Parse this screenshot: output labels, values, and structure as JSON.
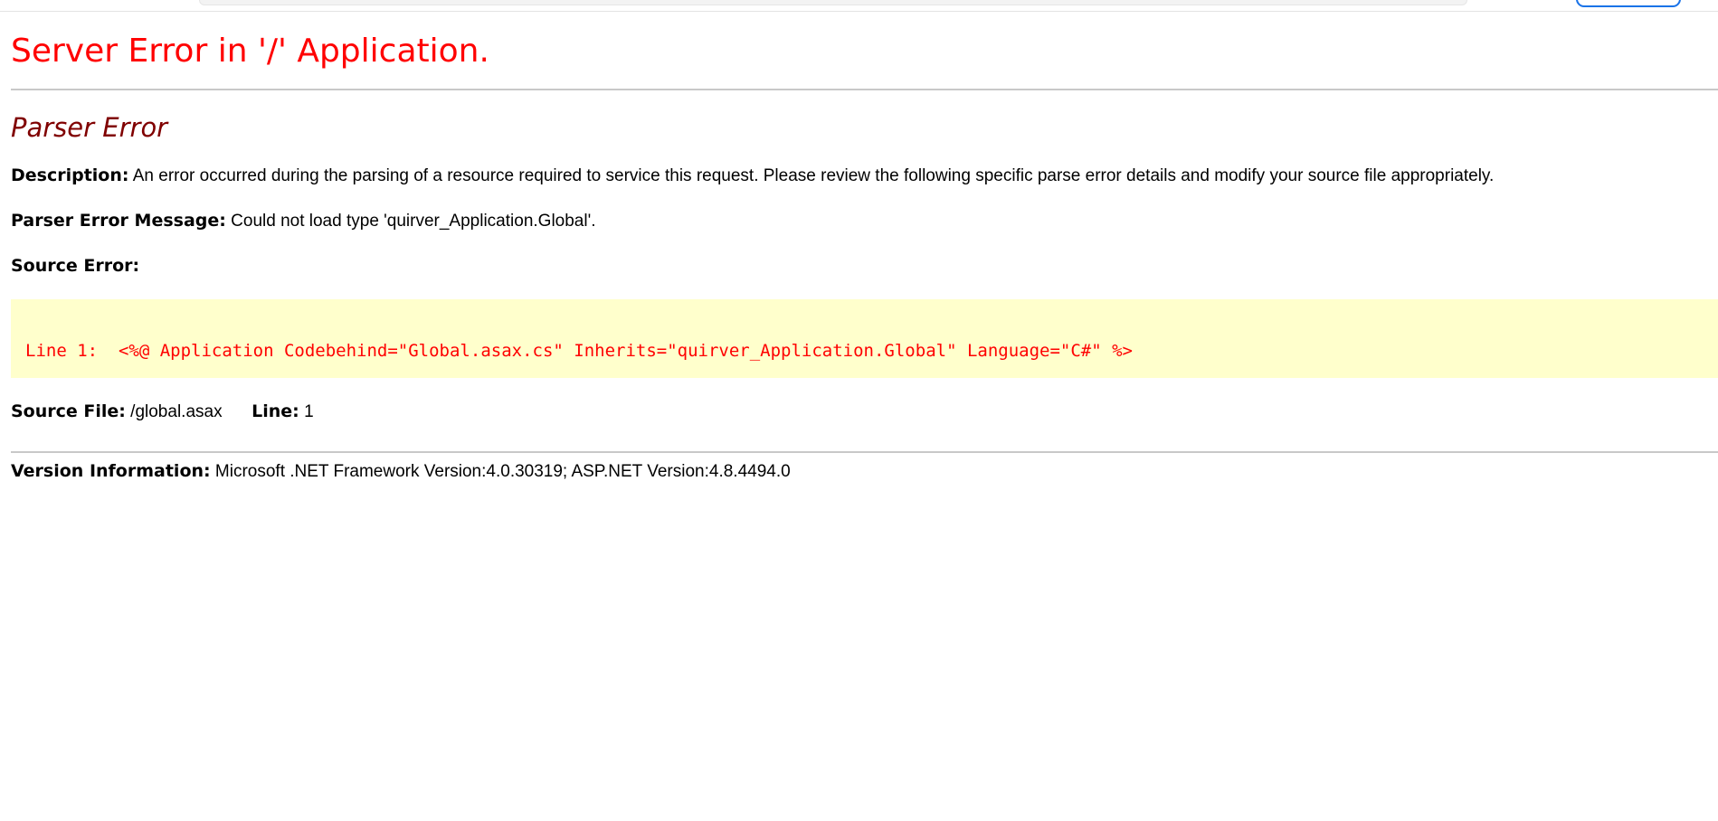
{
  "page": {
    "title": "Server Error in '/' Application.",
    "error_type": "Parser Error"
  },
  "description": {
    "label": "Description:",
    "text": "An error occurred during the parsing of a resource required to service this request. Please review the following specific parse error details and modify your source file appropriately."
  },
  "parser_error_message": {
    "label": "Parser Error Message:",
    "text": "Could not load type 'quirver_Application.Global'."
  },
  "source_error": {
    "label": "Source Error:",
    "code_line": "Line 1:  <%@ Application Codebehind=\"Global.asax.cs\" Inherits=\"quirver_Application.Global\" Language=\"C#\" %>"
  },
  "source_file": {
    "label": "Source File:",
    "value": "/global.asax",
    "line_label": "Line:",
    "line_value": "1"
  },
  "version": {
    "label": "Version Information:",
    "text": "Microsoft .NET Framework Version:4.0.30319; ASP.NET Version:4.8.4494.0"
  },
  "colors": {
    "title": "#ff0000",
    "error_type": "#800000",
    "code_background": "#ffffcc",
    "code_text": "#ff0000",
    "rule": "#c8c8c8"
  }
}
